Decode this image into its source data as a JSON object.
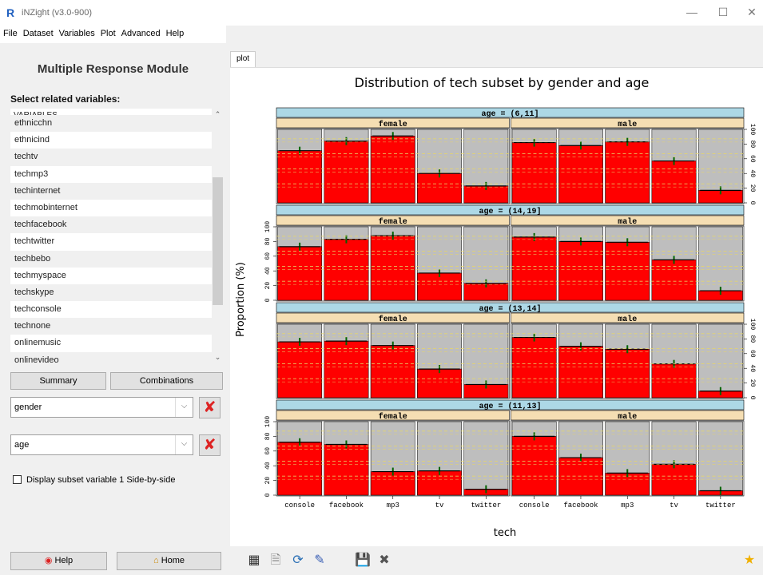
{
  "window": {
    "icon": "R",
    "title": "iNZight (v3.0-900)",
    "minimize": "—",
    "maximize": "☐",
    "close": "✕"
  },
  "menu": [
    "File",
    "Dataset",
    "Variables",
    "Plot",
    "Advanced",
    "Help"
  ],
  "left": {
    "module_title": "Multiple Response Module",
    "select_label": "Select related variables:",
    "variables_header": "VARIABLES",
    "variables": [
      "ethnicchn",
      "ethnicind",
      "techtv",
      "techmp3",
      "techinternet",
      "techmobinternet",
      "techfacebook",
      "techtwitter",
      "techbebo",
      "techmyspace",
      "techskype",
      "techconsole",
      "technone",
      "onlinemusic",
      "onlinevideo"
    ],
    "summary_button": "Summary",
    "combinations_button": "Combinations",
    "subset1": "gender",
    "subset2": "age",
    "side_by_side_label": "Display subset variable 1 Side-by-side"
  },
  "bottom": {
    "help_label": "Help",
    "home_label": "Home"
  },
  "icons": [
    "inzight-icon",
    "new-doc-icon",
    "refresh-icon",
    "edit-icon",
    "save-icon",
    "close-icon",
    "star-icon"
  ],
  "plot_tab": "plot",
  "colors": {
    "bar": "#ff0000",
    "bar_bg": "#bebebe",
    "strip_age": "#add8e6",
    "strip_gender": "#f5deb3",
    "error": "#006400",
    "grid": "#e6d66a"
  },
  "chart_data": {
    "type": "bar",
    "title": "Distribution of tech subset by gender and age",
    "xlabel": "tech",
    "ylabel": "Proportion (%)",
    "ylim": [
      0,
      100
    ],
    "yticks": [
      0,
      20,
      40,
      60,
      80,
      100
    ],
    "categories": [
      "console",
      "facebook",
      "mp3",
      "tv",
      "twitter"
    ],
    "panels": [
      {
        "age": "age = (6,11]",
        "groups": [
          {
            "gender": "female",
            "values": [
              71,
              84,
              91,
              40,
              23
            ]
          },
          {
            "gender": "male",
            "values": [
              82,
              78,
              83,
              57,
              17
            ]
          }
        ]
      },
      {
        "age": "age = (14,19]",
        "groups": [
          {
            "gender": "female",
            "values": [
              73,
              83,
              88,
              37,
              23
            ]
          },
          {
            "gender": "male",
            "values": [
              86,
              80,
              79,
              55,
              13
            ]
          }
        ]
      },
      {
        "age": "age = (13,14]",
        "groups": [
          {
            "gender": "female",
            "values": [
              76,
              77,
              71,
              39,
              18
            ]
          },
          {
            "gender": "male",
            "values": [
              82,
              70,
              66,
              46,
              9
            ]
          }
        ]
      },
      {
        "age": "age = (11,13]",
        "groups": [
          {
            "gender": "female",
            "values": [
              72,
              69,
              32,
              33,
              8
            ]
          },
          {
            "gender": "male",
            "values": [
              80,
              51,
              30,
              42,
              6
            ]
          }
        ]
      }
    ]
  }
}
